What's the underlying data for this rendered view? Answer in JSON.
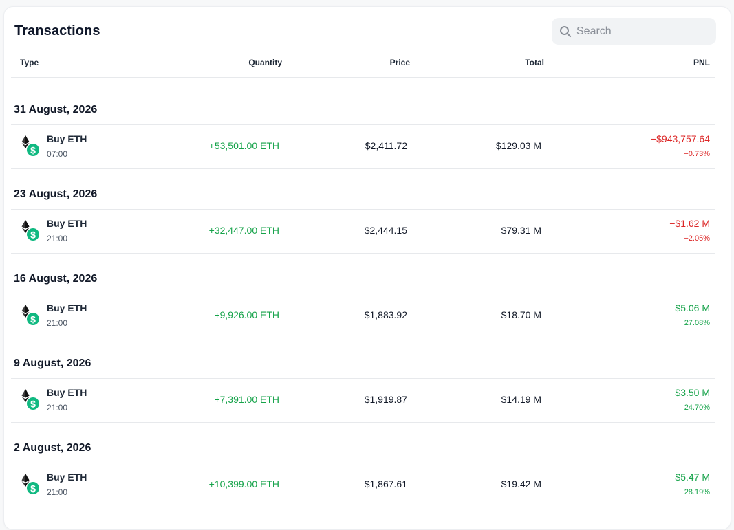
{
  "header": {
    "title": "Transactions",
    "search_placeholder": "Search"
  },
  "columns": {
    "type": "Type",
    "quantity": "Quantity",
    "price": "Price",
    "total": "Total",
    "pnl": "PNL"
  },
  "colors": {
    "positive": "#16a34a",
    "negative": "#dc2626",
    "coin_badge": "#10b981"
  },
  "groups": [
    {
      "date": "31 August, 2026",
      "row": {
        "type": "Buy ETH",
        "time": "07:00",
        "quantity": "+53,501.00 ETH",
        "price": "$2,411.72",
        "total": "$129.03 M",
        "pnl": "−$943,757.64",
        "pnl_pct": "−0.73%",
        "pnl_sign": "neg"
      }
    },
    {
      "date": "23 August, 2026",
      "row": {
        "type": "Buy ETH",
        "time": "21:00",
        "quantity": "+32,447.00 ETH",
        "price": "$2,444.15",
        "total": "$79.31 M",
        "pnl": "−$1.62 M",
        "pnl_pct": "−2.05%",
        "pnl_sign": "neg"
      }
    },
    {
      "date": "16 August, 2026",
      "row": {
        "type": "Buy ETH",
        "time": "21:00",
        "quantity": "+9,926.00 ETH",
        "price": "$1,883.92",
        "total": "$18.70 M",
        "pnl": "$5.06 M",
        "pnl_pct": "27.08%",
        "pnl_sign": "pos"
      }
    },
    {
      "date": "9 August, 2026",
      "row": {
        "type": "Buy ETH",
        "time": "21:00",
        "quantity": "+7,391.00 ETH",
        "price": "$1,919.87",
        "total": "$14.19 M",
        "pnl": "$3.50 M",
        "pnl_pct": "24.70%",
        "pnl_sign": "pos"
      }
    },
    {
      "date": "2 August, 2026",
      "row": {
        "type": "Buy ETH",
        "time": "21:00",
        "quantity": "+10,399.00 ETH",
        "price": "$1,867.61",
        "total": "$19.42 M",
        "pnl": "$5.47 M",
        "pnl_pct": "28.19%",
        "pnl_sign": "pos"
      }
    }
  ]
}
